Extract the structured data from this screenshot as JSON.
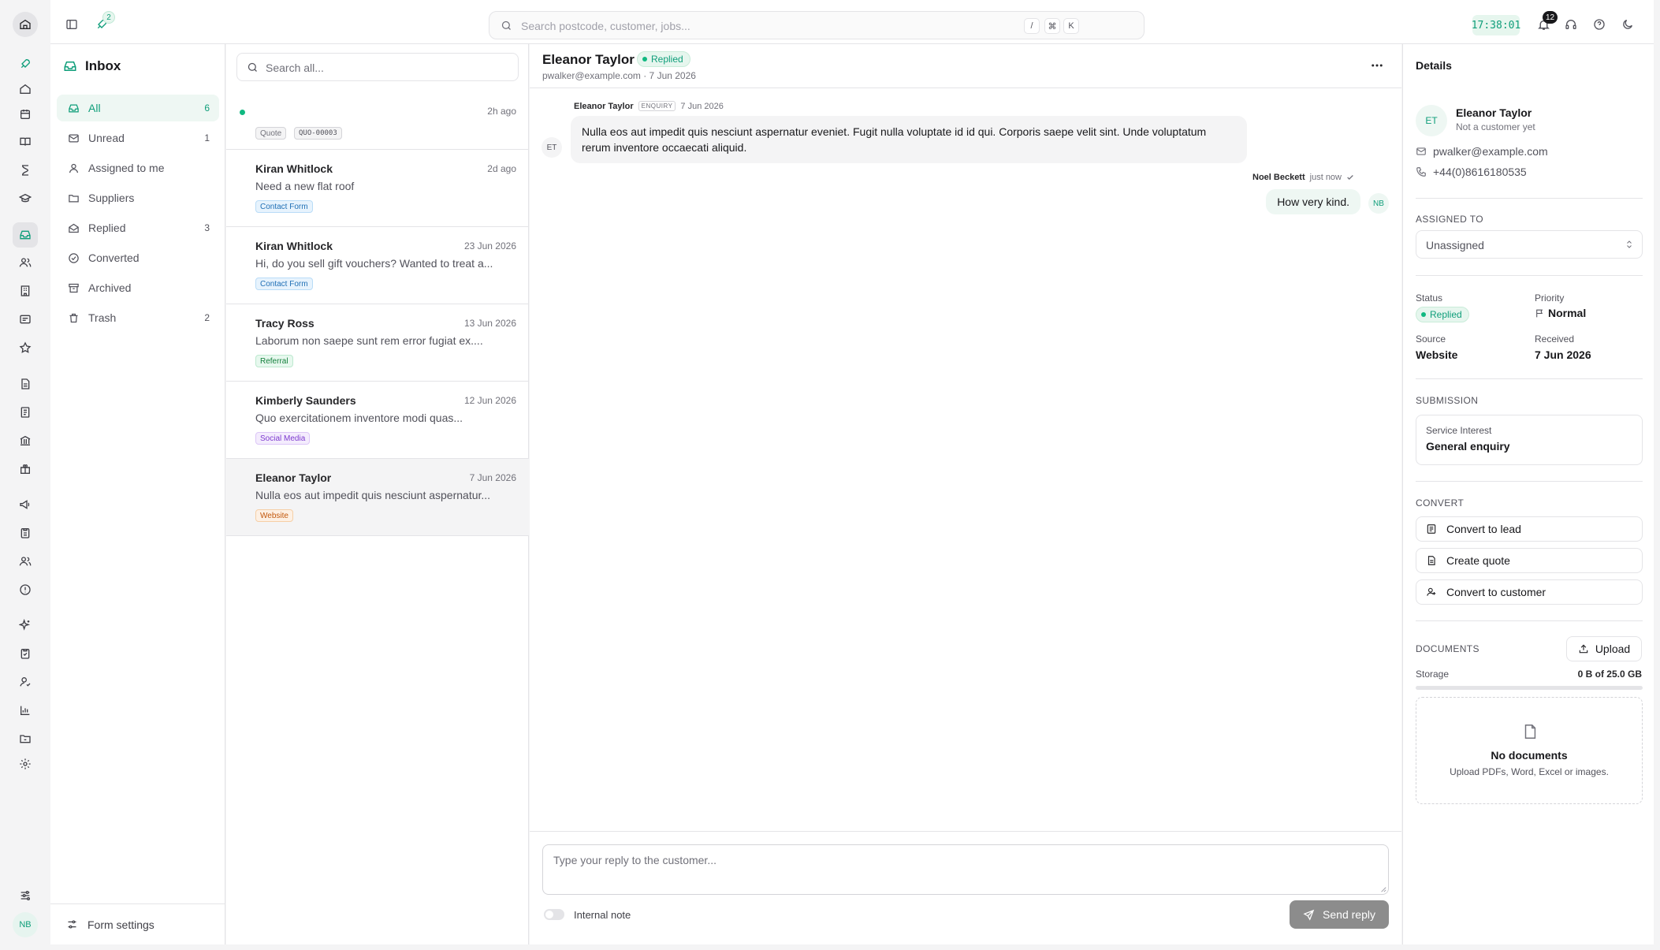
{
  "topbar": {
    "rocket_badge": "2",
    "search_placeholder": "Search postcode, customer, jobs...",
    "kbd_slash": "/",
    "kbd_cmd": "⌘",
    "kbd_k": "K",
    "clock": "17:38:01",
    "notifications_count": "12"
  },
  "rail": {
    "avatar": "NB"
  },
  "inbox": {
    "title": "Inbox",
    "folders": [
      {
        "label": "All",
        "count": "6"
      },
      {
        "label": "Unread",
        "count": "1"
      },
      {
        "label": "Assigned to me",
        "count": ""
      },
      {
        "label": "Suppliers",
        "count": ""
      },
      {
        "label": "Replied",
        "count": "3"
      },
      {
        "label": "Converted",
        "count": ""
      },
      {
        "label": "Archived",
        "count": ""
      },
      {
        "label": "Trash",
        "count": "2"
      }
    ],
    "form_settings": "Form settings"
  },
  "list": {
    "search_placeholder": "Search all...",
    "items": [
      {
        "name": "",
        "date": "2h ago",
        "preview": "",
        "tag": "Quote",
        "tag2": "QUO-00003"
      },
      {
        "name": "Kiran Whitlock",
        "date": "2d ago",
        "preview": "Need a new flat roof",
        "tag": "Contact Form"
      },
      {
        "name": "Kiran Whitlock",
        "date": "23 Jun 2026",
        "preview": "Hi, do you sell gift vouchers? Wanted to treat a...",
        "tag": "Contact Form"
      },
      {
        "name": "Tracy Ross",
        "date": "13 Jun 2026",
        "preview": "Laborum non saepe sunt rem error fugiat ex....",
        "tag": "Referral"
      },
      {
        "name": "Kimberly Saunders",
        "date": "12 Jun 2026",
        "preview": "Quo exercitationem inventore modi quas...",
        "tag": "Social Media"
      },
      {
        "name": "Eleanor Taylor",
        "date": "7 Jun 2026",
        "preview": "Nulla eos aut impedit quis nesciunt aspernatur...",
        "tag": "Website"
      }
    ]
  },
  "thread": {
    "name": "Eleanor Taylor",
    "status": "Replied",
    "sub": "pwalker@example.com · 7 Jun 2026",
    "incoming": {
      "author": "Eleanor Taylor",
      "chip": "ENQUIRY",
      "date": "7 Jun 2026",
      "initials": "ET",
      "body": "Nulla eos aut impedit quis nesciunt aspernatur eveniet. Fugit nulla voluptate id id qui. Corporis saepe velit sint. Unde voluptatum rerum inventore occaecati aliquid."
    },
    "outgoing": {
      "author": "Noel Beckett",
      "time": "just now",
      "initials": "NB",
      "body": "How very kind."
    },
    "reply_placeholder": "Type your reply to the customer...",
    "internal_note": "Internal note",
    "send": "Send reply"
  },
  "details": {
    "title": "Details",
    "initials": "ET",
    "name": "Eleanor Taylor",
    "customer_status": "Not a customer yet",
    "email": "pwalker@example.com",
    "phone": "+44(0)8616180535",
    "assigned_label": "ASSIGNED TO",
    "assigned_value": "Unassigned",
    "status_label": "Status",
    "status_value": "Replied",
    "priority_label": "Priority",
    "priority_value": "Normal",
    "source_label": "Source",
    "source_value": "Website",
    "received_label": "Received",
    "received_value": "7 Jun 2026",
    "submission_label": "SUBMISSION",
    "service_label": "Service Interest",
    "service_value": "General enquiry",
    "convert_label": "CONVERT",
    "convert_lead": "Convert to lead",
    "create_quote": "Create quote",
    "convert_customer": "Convert to customer",
    "documents_label": "DOCUMENTS",
    "upload": "Upload",
    "storage_label": "Storage",
    "storage_value": "0 B of 25.0 GB",
    "storage_fraction": 0,
    "no_docs_title": "No documents",
    "no_docs_sub": "Upload PDFs, Word, Excel or images."
  },
  "colors": {
    "accent": "#0f9e7a",
    "border": "#e4e4e7",
    "muted": "#71717a"
  }
}
